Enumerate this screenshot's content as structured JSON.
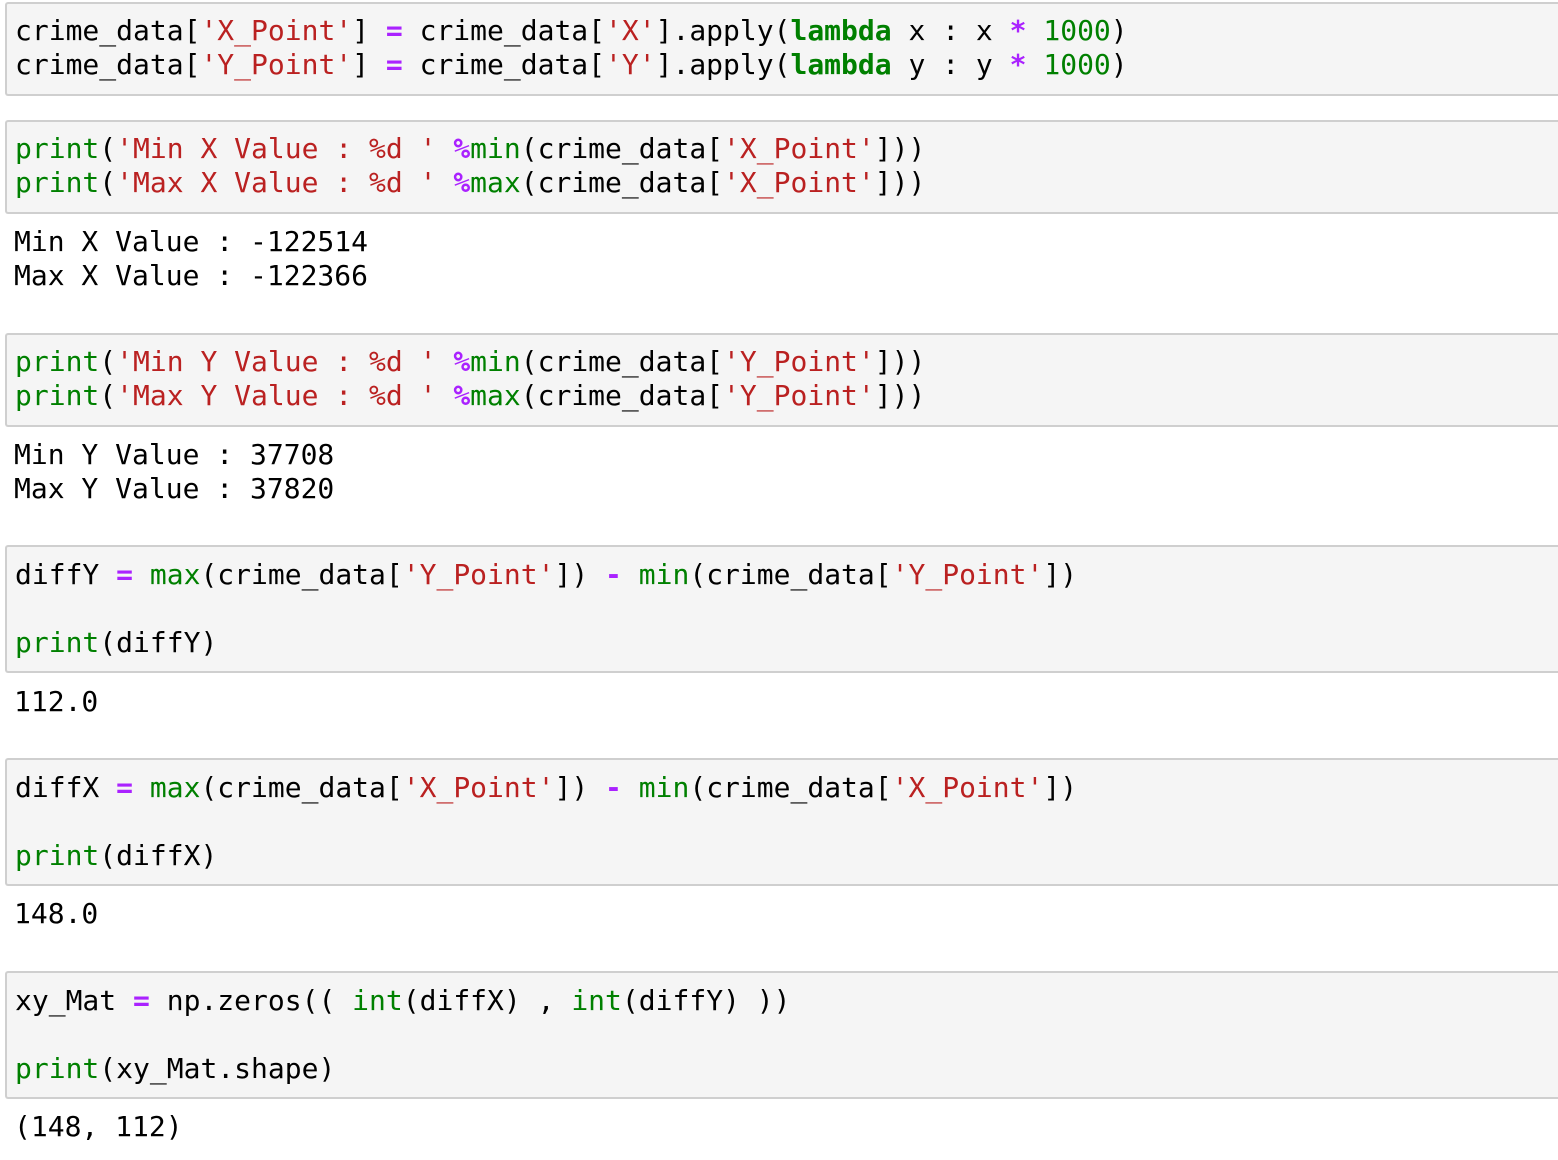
{
  "colors": {
    "cell_background": "#f5f5f5",
    "cell_border": "#cfcfcf",
    "plain": "#000000",
    "string": "#ba2121",
    "operator": "#aa22ff",
    "keyword": "#008000",
    "builtin": "#008000",
    "number": "#008000"
  },
  "cells": [
    {
      "input": [
        [
          [
            "n",
            "crime_data["
          ],
          [
            "s",
            "'X_Point'"
          ],
          [
            "n",
            "] "
          ],
          [
            "o",
            "="
          ],
          [
            "n",
            " crime_data["
          ],
          [
            "s",
            "'X'"
          ],
          [
            "n",
            "].apply("
          ],
          [
            "k",
            "lambda"
          ],
          [
            "n",
            " x : x "
          ],
          [
            "o",
            "*"
          ],
          [
            "n",
            " "
          ],
          [
            "m",
            "1000"
          ],
          [
            "n",
            ")"
          ]
        ],
        [
          [
            "n",
            "crime_data["
          ],
          [
            "s",
            "'Y_Point'"
          ],
          [
            "n",
            "] "
          ],
          [
            "o",
            "="
          ],
          [
            "n",
            " crime_data["
          ],
          [
            "s",
            "'Y'"
          ],
          [
            "n",
            "].apply("
          ],
          [
            "k",
            "lambda"
          ],
          [
            "n",
            " y : y "
          ],
          [
            "o",
            "*"
          ],
          [
            "n",
            " "
          ],
          [
            "m",
            "1000"
          ],
          [
            "n",
            ")"
          ]
        ]
      ],
      "output": []
    },
    {
      "input": [
        [
          [
            "b",
            "print"
          ],
          [
            "n",
            "("
          ],
          [
            "s",
            "'Min X Value : %d '"
          ],
          [
            "n",
            " "
          ],
          [
            "o",
            "%"
          ],
          [
            "b",
            "min"
          ],
          [
            "n",
            "(crime_data["
          ],
          [
            "s",
            "'X_Point'"
          ],
          [
            "n",
            "]))"
          ]
        ],
        [
          [
            "b",
            "print"
          ],
          [
            "n",
            "("
          ],
          [
            "s",
            "'Max X Value : %d '"
          ],
          [
            "n",
            " "
          ],
          [
            "o",
            "%"
          ],
          [
            "b",
            "max"
          ],
          [
            "n",
            "(crime_data["
          ],
          [
            "s",
            "'X_Point'"
          ],
          [
            "n",
            "]))"
          ]
        ]
      ],
      "output": [
        "Min X Value : -122514",
        "Max X Value : -122366"
      ]
    },
    {
      "input": [
        [
          [
            "b",
            "print"
          ],
          [
            "n",
            "("
          ],
          [
            "s",
            "'Min Y Value : %d '"
          ],
          [
            "n",
            " "
          ],
          [
            "o",
            "%"
          ],
          [
            "b",
            "min"
          ],
          [
            "n",
            "(crime_data["
          ],
          [
            "s",
            "'Y_Point'"
          ],
          [
            "n",
            "]))"
          ]
        ],
        [
          [
            "b",
            "print"
          ],
          [
            "n",
            "("
          ],
          [
            "s",
            "'Max Y Value : %d '"
          ],
          [
            "n",
            " "
          ],
          [
            "o",
            "%"
          ],
          [
            "b",
            "max"
          ],
          [
            "n",
            "(crime_data["
          ],
          [
            "s",
            "'Y_Point'"
          ],
          [
            "n",
            "]))"
          ]
        ]
      ],
      "output": [
        "Min Y Value : 37708",
        "Max Y Value : 37820"
      ]
    },
    {
      "input": [
        [
          [
            "n",
            "diffY "
          ],
          [
            "o",
            "="
          ],
          [
            "n",
            " "
          ],
          [
            "b",
            "max"
          ],
          [
            "n",
            "(crime_data["
          ],
          [
            "s",
            "'Y_Point'"
          ],
          [
            "n",
            "]) "
          ],
          [
            "o",
            "-"
          ],
          [
            "n",
            " "
          ],
          [
            "b",
            "min"
          ],
          [
            "n",
            "(crime_data["
          ],
          [
            "s",
            "'Y_Point'"
          ],
          [
            "n",
            "])"
          ]
        ],
        [],
        [
          [
            "b",
            "print"
          ],
          [
            "n",
            "(diffY)"
          ]
        ]
      ],
      "output": [
        "112.0"
      ]
    },
    {
      "input": [
        [
          [
            "n",
            "diffX "
          ],
          [
            "o",
            "="
          ],
          [
            "n",
            " "
          ],
          [
            "b",
            "max"
          ],
          [
            "n",
            "(crime_data["
          ],
          [
            "s",
            "'X_Point'"
          ],
          [
            "n",
            "]) "
          ],
          [
            "o",
            "-"
          ],
          [
            "n",
            " "
          ],
          [
            "b",
            "min"
          ],
          [
            "n",
            "(crime_data["
          ],
          [
            "s",
            "'X_Point'"
          ],
          [
            "n",
            "])"
          ]
        ],
        [],
        [
          [
            "b",
            "print"
          ],
          [
            "n",
            "(diffX)"
          ]
        ]
      ],
      "output": [
        "148.0"
      ]
    },
    {
      "input": [
        [
          [
            "n",
            "xy_Mat "
          ],
          [
            "o",
            "="
          ],
          [
            "n",
            " np.zeros(( "
          ],
          [
            "b",
            "int"
          ],
          [
            "n",
            "(diffX) , "
          ],
          [
            "b",
            "int"
          ],
          [
            "n",
            "(diffY) ))"
          ]
        ],
        [],
        [
          [
            "b",
            "print"
          ],
          [
            "n",
            "(xy_Mat.shape)"
          ]
        ]
      ],
      "output": [
        "(148, 112)"
      ]
    }
  ]
}
